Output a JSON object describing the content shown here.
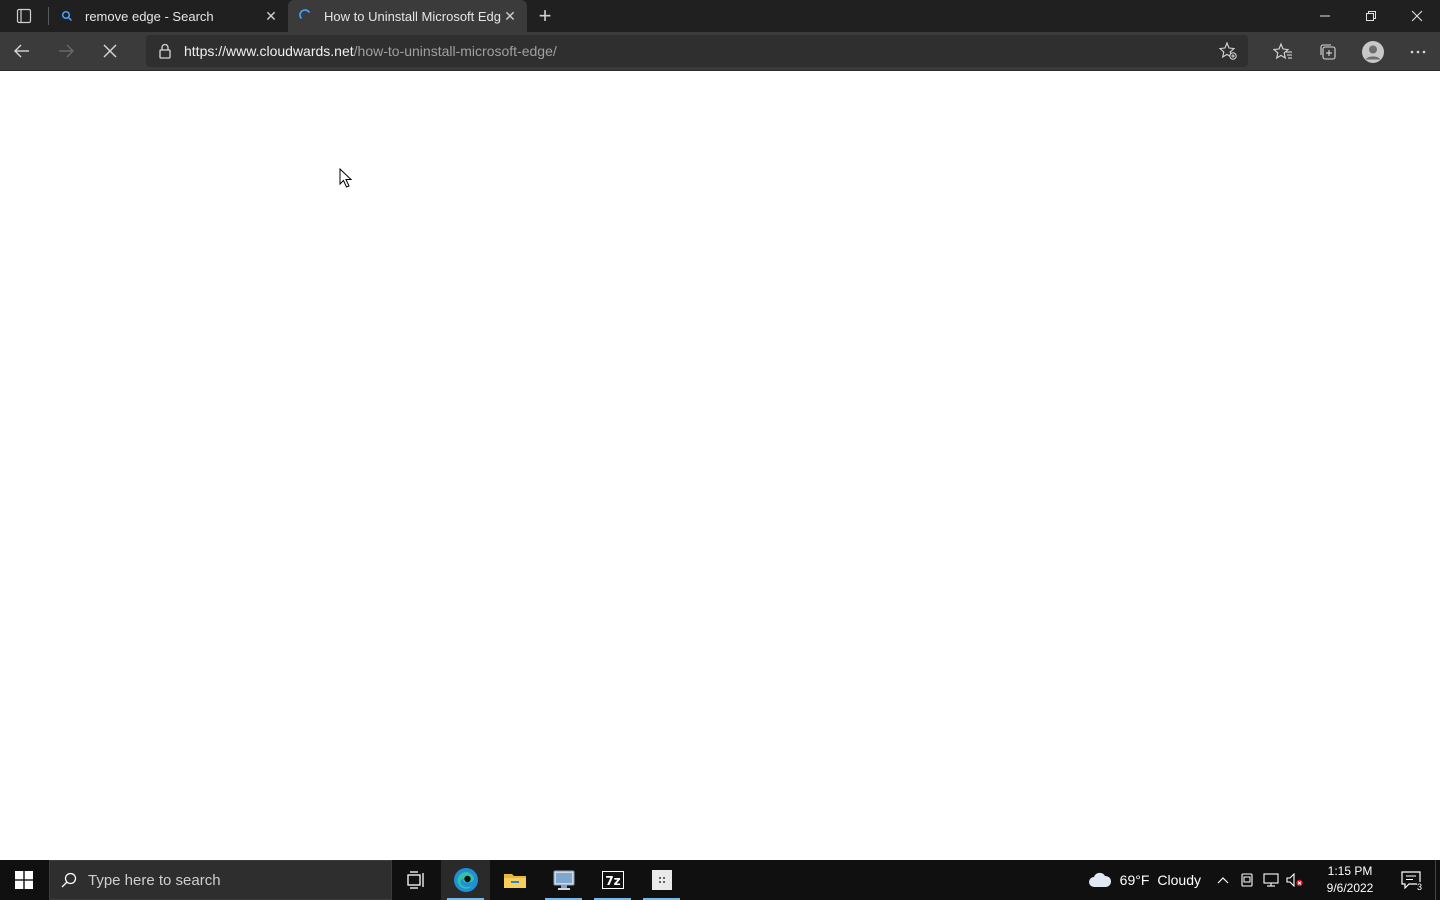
{
  "browser": {
    "tabs": [
      {
        "title": "remove edge - Search",
        "icon": "search-icon",
        "active": false
      },
      {
        "title": "How to Uninstall Microsoft Edge",
        "icon": "loading-spinner-icon",
        "active": true
      }
    ],
    "address": {
      "scheme": "https://",
      "host": "www.cloudwards.net",
      "path": "/how-to-uninstall-microsoft-edge/"
    }
  },
  "taskbar": {
    "search_placeholder": "Type here to search",
    "apps": [
      "task-view",
      "microsoft-edge",
      "file-explorer",
      "remote-desktop",
      "7-zip",
      "app"
    ],
    "weather": {
      "temp": "69°F",
      "condition": "Cloudy"
    },
    "clock": {
      "time": "1:15 PM",
      "date": "9/6/2022"
    },
    "notification_count": "3"
  },
  "colors": {
    "titlebar": "#202020",
    "toolbar": "#3b3b3b",
    "taskbar": "#101010",
    "accent": "#76b9ed"
  }
}
